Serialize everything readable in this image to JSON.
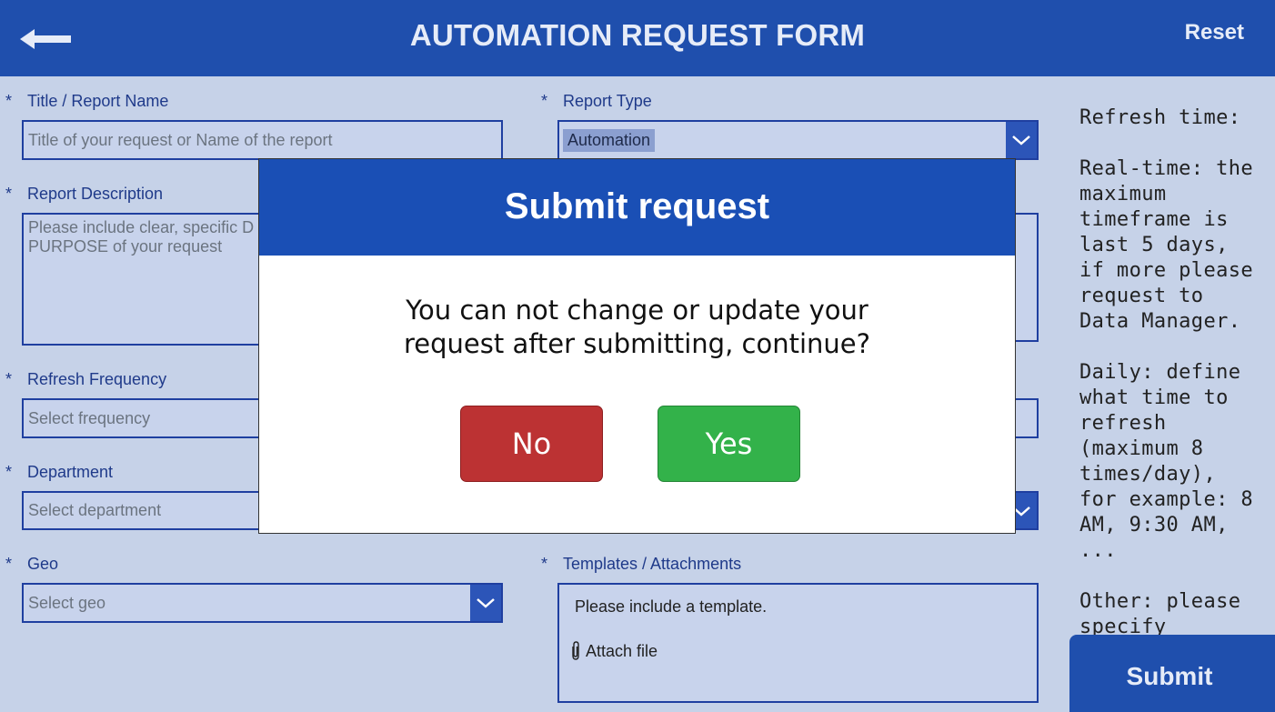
{
  "header": {
    "title": "AUTOMATION REQUEST FORM",
    "reset_label": "Reset",
    "back_icon": "arrow-left-icon"
  },
  "form": {
    "required_marker": "*",
    "title_field": {
      "label": "Title / Report Name",
      "placeholder": "Title of your request or Name of the report"
    },
    "report_type": {
      "label": "Report Type",
      "value": "Automation"
    },
    "description": {
      "label": "Report Description",
      "placeholder_line1": "Please include clear, specific D",
      "placeholder_line2": "PURPOSE of your request"
    },
    "refresh_frequency": {
      "label": "Refresh Frequency",
      "placeholder": "Select frequency"
    },
    "department": {
      "label": "Department",
      "placeholder": "Select department"
    },
    "geo": {
      "label": "Geo",
      "placeholder": "Select geo"
    },
    "templates": {
      "label": "Templates / Attachments",
      "hint": "Please include a template.",
      "attach_label": "Attach file"
    }
  },
  "help": {
    "p1": "Refresh time:",
    "p2": "Real-time: the maximum timeframe is last 5 days, if more please request to Data Manager.",
    "p3": "Daily: define what time to refresh (maximum 8 times/day), for example: 8 AM, 9:30 AM, ...",
    "p4": "Other: please specify clearly."
  },
  "submit_label": "Submit",
  "modal": {
    "title": "Submit request",
    "message_line1": "You can not change or update your",
    "message_line2": "request after submitting, continue?",
    "no_label": "No",
    "yes_label": "Yes"
  },
  "colors": {
    "header": "#1f4fad",
    "background": "#c6d2e8",
    "modal_header": "#1a4fb5",
    "no_button": "#bc3233",
    "yes_button": "#33b24a"
  }
}
